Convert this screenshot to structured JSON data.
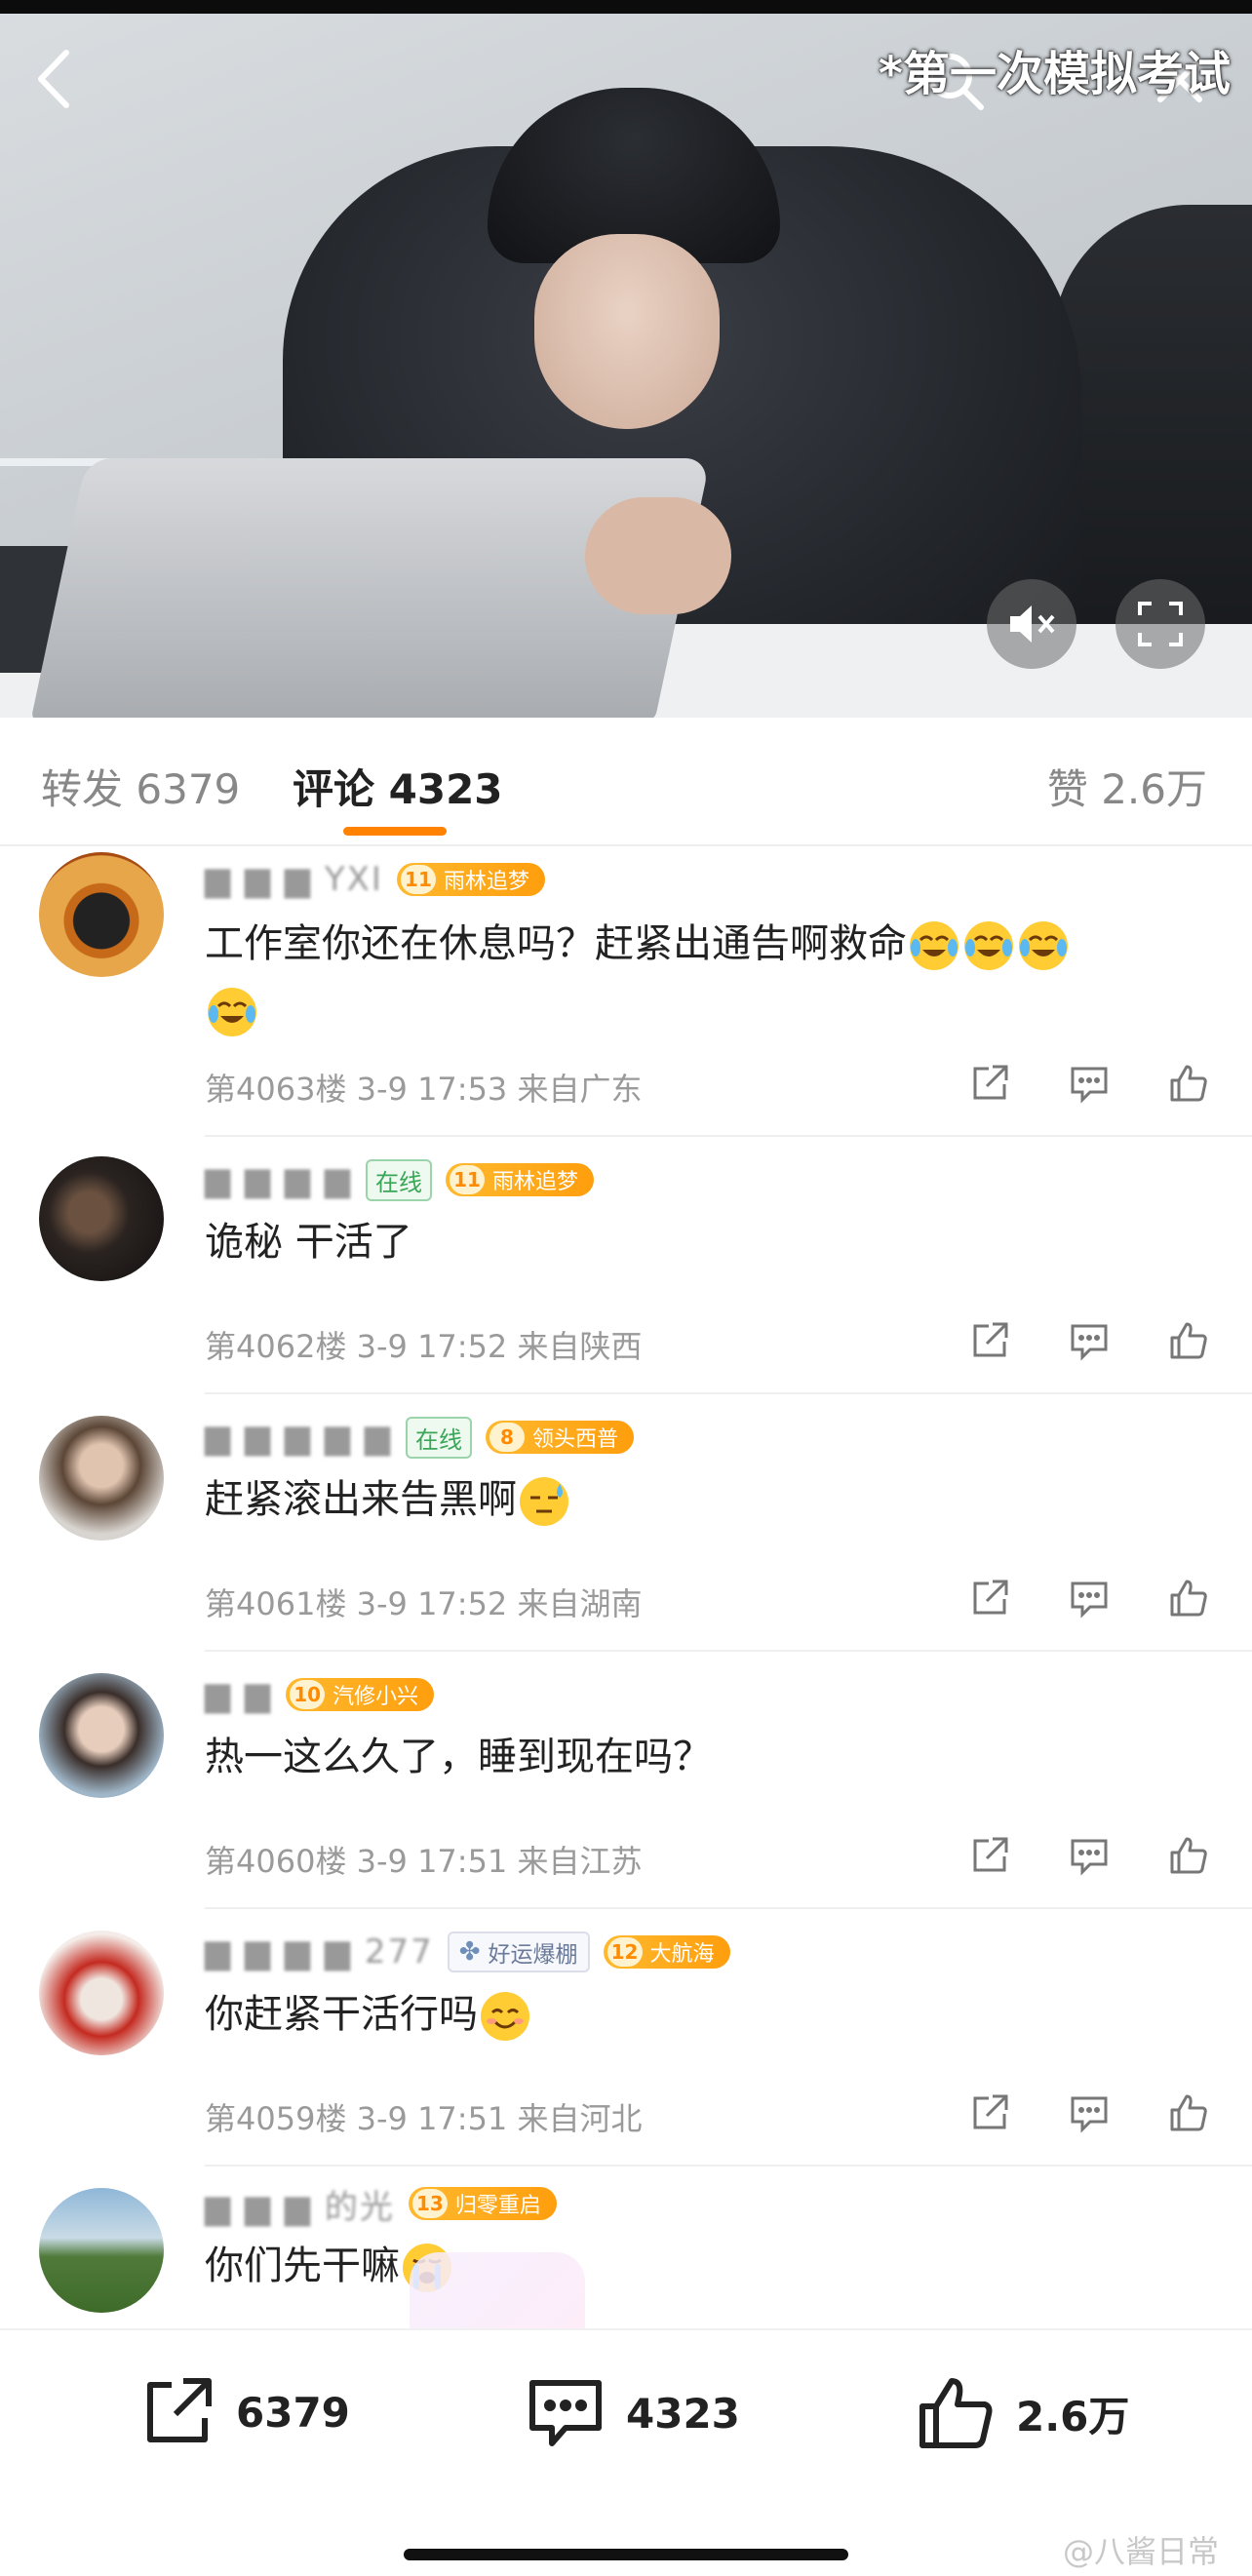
{
  "video": {
    "caption": "*第一次模拟考试",
    "icons": [
      "back-arrow-icon",
      "search-icon",
      "close-icon",
      "mute-icon",
      "fullscreen-icon"
    ]
  },
  "tabs": {
    "repost_label": "转发",
    "repost_count": "6379",
    "comment_label": "评论",
    "comment_count": "4323",
    "like_label": "赞",
    "like_count": "2.6万",
    "accent": "#ff8200"
  },
  "comments": [
    {
      "name": "▆ ▆ ▆ YXI",
      "online": "",
      "lucky": "",
      "fan_level": "11",
      "fan_title": "雨林追梦",
      "text": "工作室你还在休息吗？赶紧出通告啊救命",
      "emojis": [
        "crying-laughing",
        "crying-laughing",
        "crying-laughing",
        "crying-laughing"
      ],
      "floor": "第4063楼",
      "time": "3-9 17:53",
      "location": "来自广东"
    },
    {
      "name": "▆ ▆ ▆ ▆",
      "online": "在线",
      "lucky": "",
      "fan_level": "11",
      "fan_title": "雨林追梦",
      "text": "诡秘 干活了",
      "emojis": [],
      "floor": "第4062楼",
      "time": "3-9 17:52",
      "location": "来自陕西"
    },
    {
      "name": "▆ ▆ ▆ ▆ ▆",
      "online": "在线",
      "lucky": "",
      "fan_level": "8",
      "fan_title": "领头西普",
      "text": "赶紧滚出来告黑啊",
      "emojis": [
        "sweat"
      ],
      "floor": "第4061楼",
      "time": "3-9 17:52",
      "location": "来自湖南"
    },
    {
      "name": "▆ ▆",
      "online": "",
      "lucky": "",
      "fan_level": "10",
      "fan_title": "汽修小兴",
      "text": "热一这么久了，睡到现在吗？",
      "emojis": [],
      "floor": "第4060楼",
      "time": "3-9 17:51",
      "location": "来自江苏"
    },
    {
      "name": "▆ ▆ ▆ ▆ 277",
      "online": "",
      "lucky": "好运爆棚",
      "fan_level": "12",
      "fan_title": "大航海",
      "text": "你赶紧干活行吗",
      "emojis": [
        "smile"
      ],
      "floor": "第4059楼",
      "time": "3-9 17:51",
      "location": "来自河北"
    },
    {
      "name": "▆ ▆ ▆ 的光",
      "online": "",
      "lucky": "",
      "fan_level": "13",
      "fan_title": "归零重启",
      "text": "你们先干嘛",
      "emojis": [
        "crying"
      ],
      "floor": "",
      "time": "",
      "location": ""
    }
  ],
  "bottom_bar": {
    "repost_count": "6379",
    "comment_count": "4323",
    "like_count": "2.6万"
  },
  "watermark": "@八酱日常"
}
